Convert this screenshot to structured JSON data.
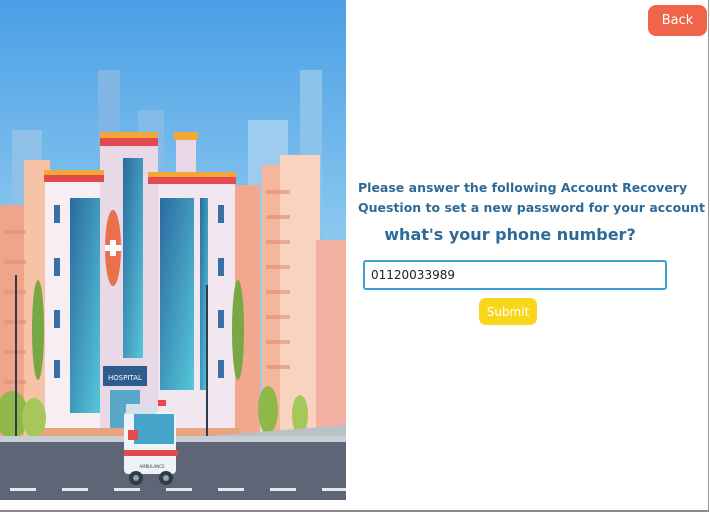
{
  "header": {
    "back_label": "Back"
  },
  "form": {
    "prompt_line1": "Please answer the following Account Recovery",
    "prompt_line2": "Question to set a new password for your account",
    "question": "what's your phone number?",
    "answer_value": "01120033989",
    "submit_label": "Submit"
  },
  "illustration": {
    "sign_text": "HOSPITAL",
    "ambulance_text": "AMBULANCE"
  },
  "colors": {
    "back_button": "#f06449",
    "submit_button": "#f8d71a",
    "text_accent": "#2f6a96",
    "input_border": "#3aa0d0"
  }
}
